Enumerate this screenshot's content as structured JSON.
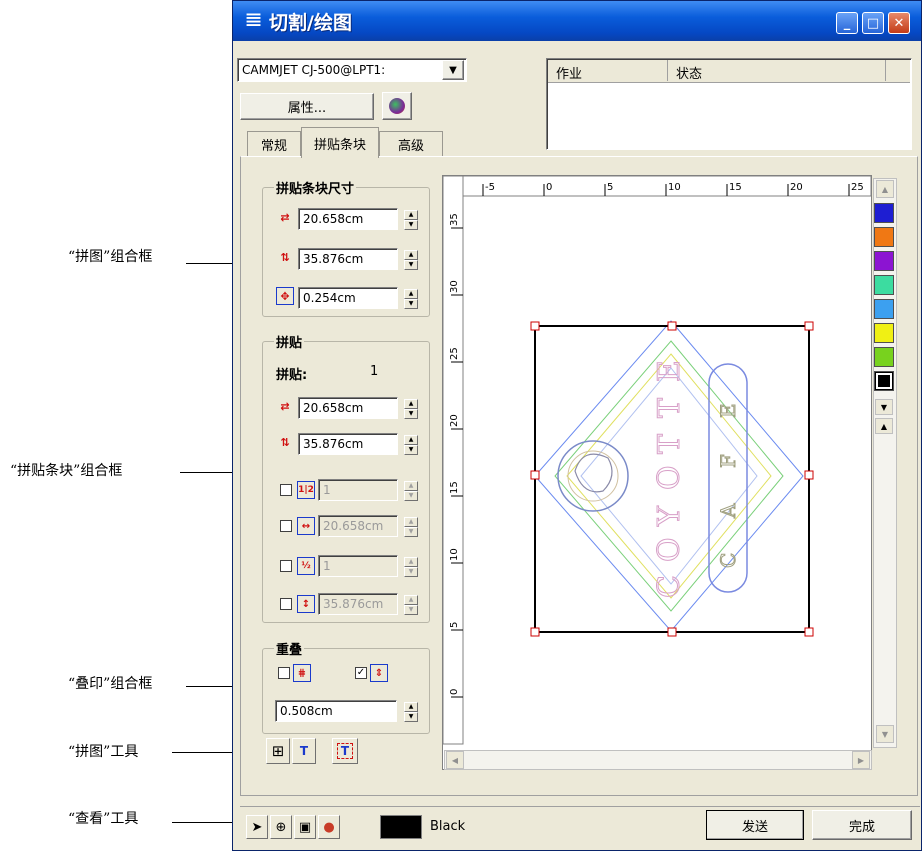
{
  "annotations": [
    {
      "key": "puzzle_group",
      "text": "“拼图”组合框"
    },
    {
      "key": "tile_group",
      "text": "“拼贴条块”组合框"
    },
    {
      "key": "overlap_group",
      "text": "“叠印”组合框"
    },
    {
      "key": "puzzle_tools",
      "text": "“拼图”工具"
    },
    {
      "key": "view_tools",
      "text": "“查看”工具"
    }
  ],
  "window": {
    "title": "切割/绘图",
    "printer": "CAMMJET CJ-500@LPT1:",
    "properties_label": "属性...",
    "jobs_header": {
      "job": "作业",
      "status": "状态"
    },
    "tabs": [
      {
        "label": "常规",
        "active": false
      },
      {
        "label": "拼贴条块",
        "active": true
      },
      {
        "label": "高级",
        "active": false
      }
    ]
  },
  "tile_size": {
    "title": "拼贴条块尺寸",
    "width": "20.658cm",
    "height": "35.876cm",
    "margin": "0.254cm"
  },
  "tiling": {
    "title": "拼贴",
    "count_label": "拼贴:",
    "count": "1",
    "width": "20.658cm",
    "height": "35.876cm",
    "opt1": "1",
    "opt2": "20.658cm",
    "opt3": "1",
    "opt4": "35.876cm"
  },
  "overlap": {
    "title": "重叠",
    "check1": false,
    "check2": true,
    "value": "0.508cm"
  },
  "ruler": {
    "x_ticks": [
      "-5",
      "0",
      "5",
      "10",
      "15",
      "20",
      "25"
    ],
    "y_ticks": [
      "35",
      "30",
      "25",
      "20",
      "15",
      "10",
      "5",
      "0"
    ]
  },
  "artwork_letters": {
    "left": [
      "E",
      "T",
      "T",
      "O",
      "Y",
      "O",
      "C"
    ],
    "right": [
      "E",
      "F",
      "A",
      "C"
    ]
  },
  "palette": [
    "#1e1ed2",
    "#f07814",
    "#8c14d2",
    "#3cdca0",
    "#3ca0f0",
    "#f0f014",
    "#78d21e",
    "#000000"
  ],
  "color_name": "Black",
  "buttons": {
    "send": "发送",
    "done": "完成"
  },
  "colors": {
    "title_bar": "#0a5ddb",
    "selection": "#cc0000"
  }
}
